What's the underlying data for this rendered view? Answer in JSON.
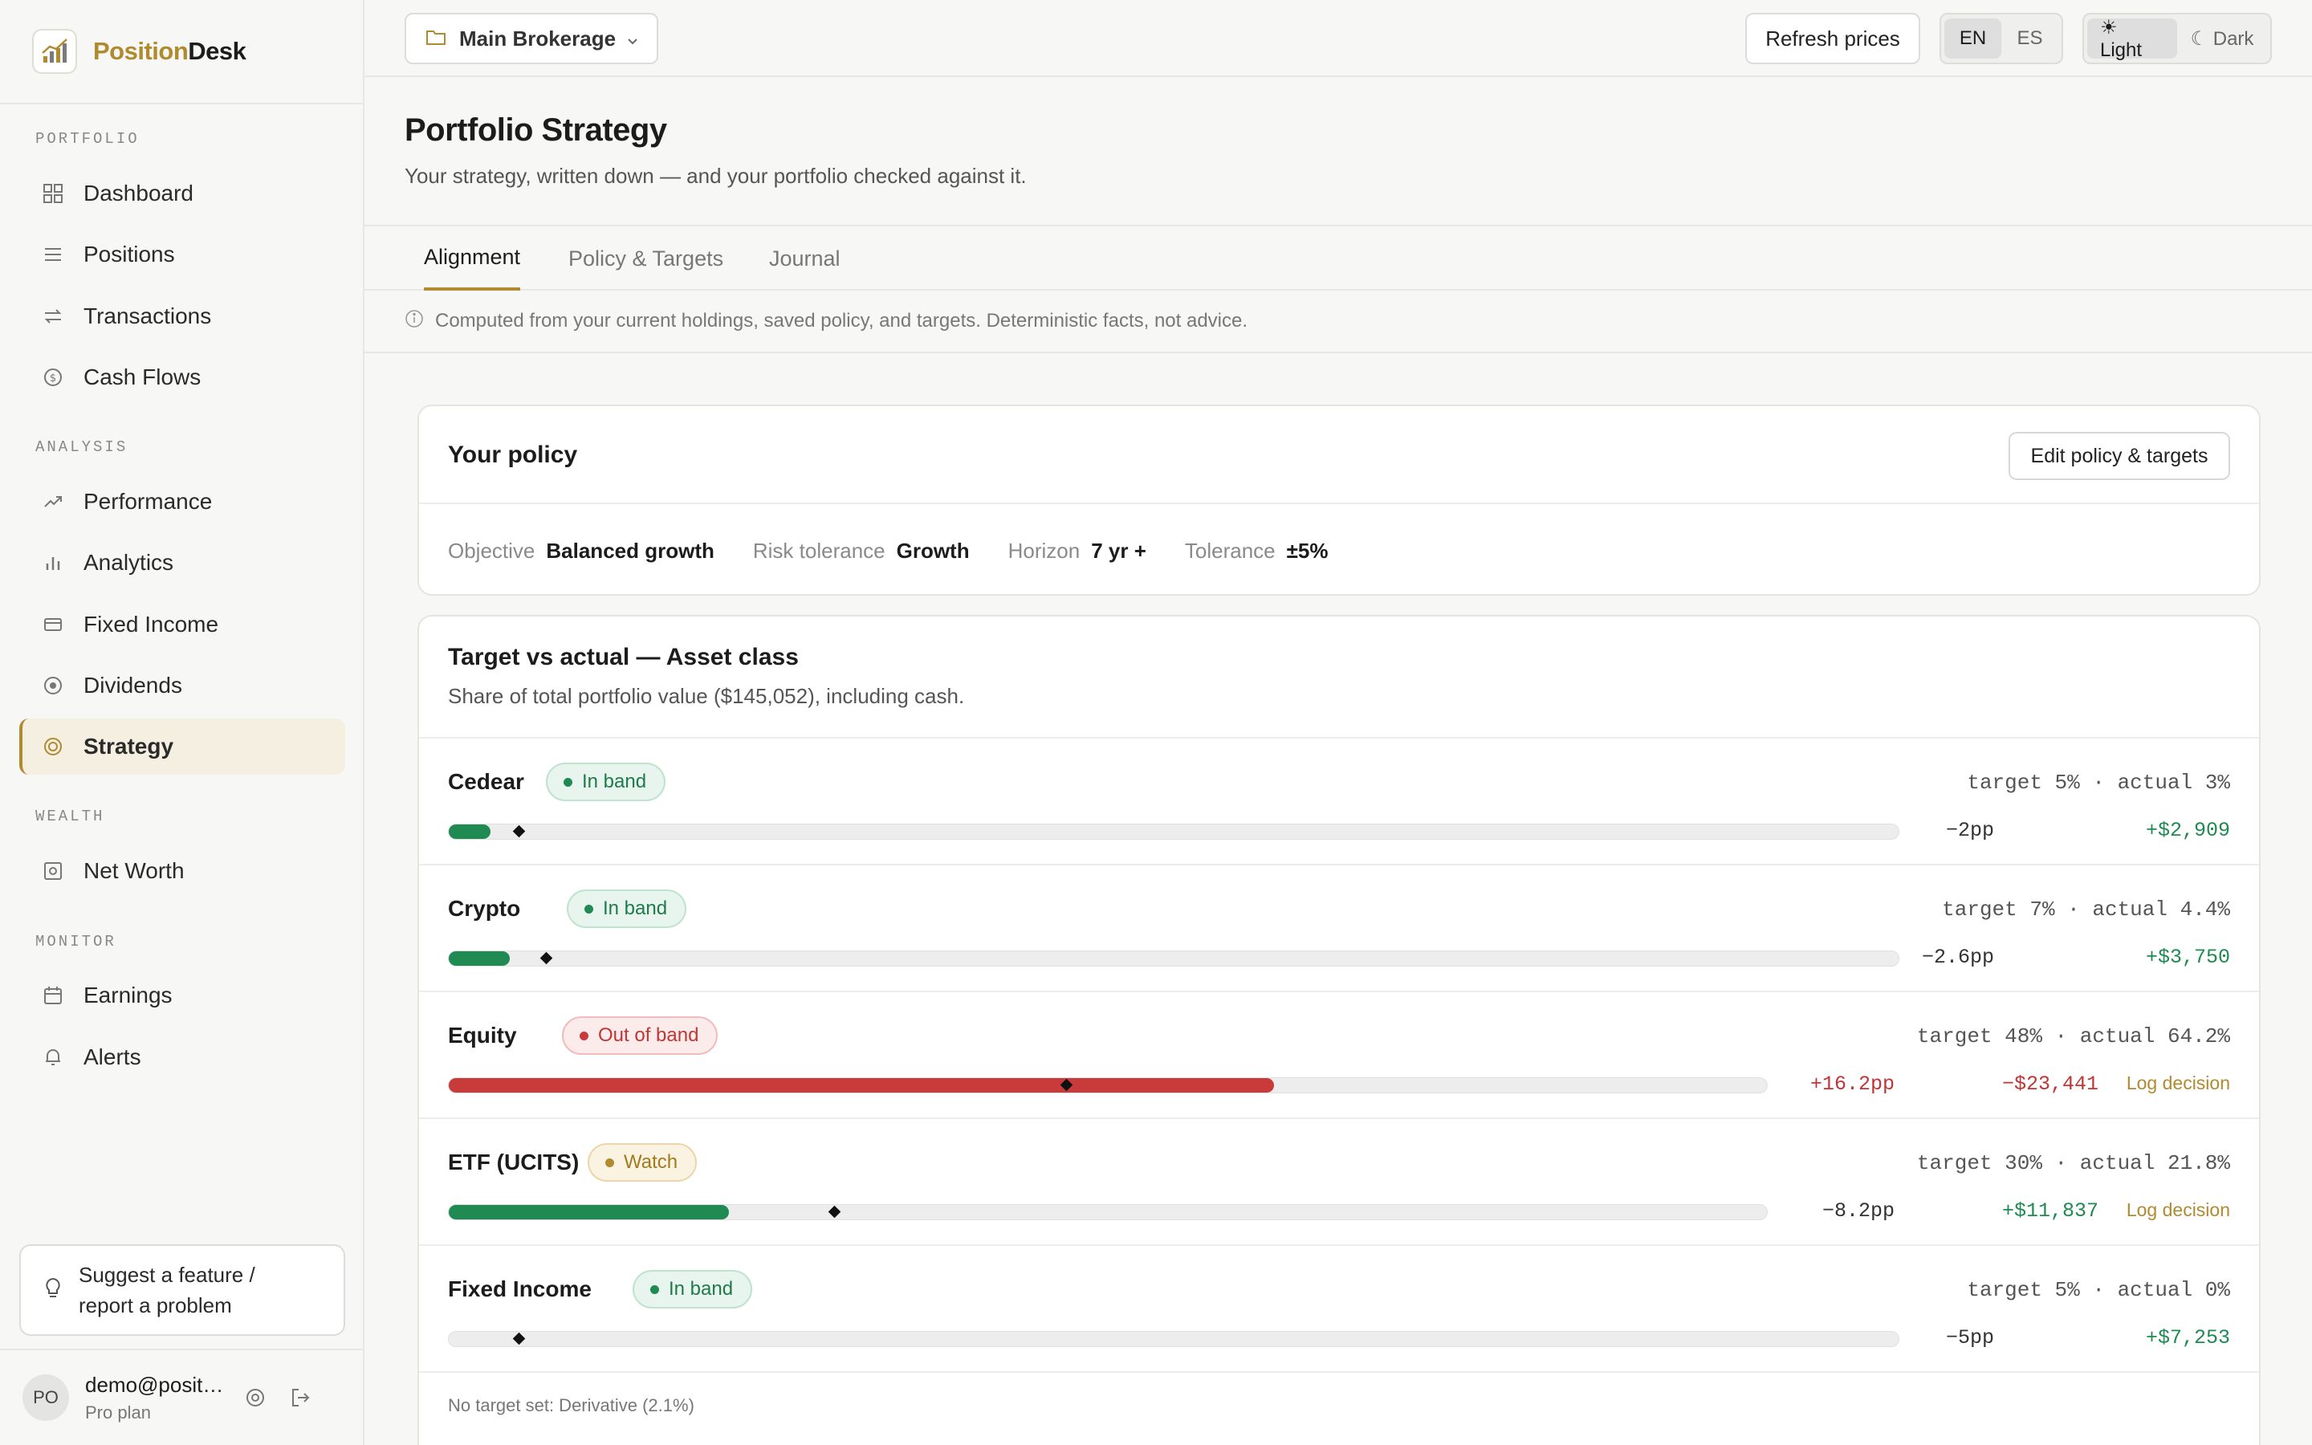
{
  "brand": {
    "name_part1": "Position",
    "name_part2": "Desk"
  },
  "sidebar": {
    "sections": [
      {
        "label": "PORTFOLIO"
      },
      {
        "label": "ANALYSIS"
      },
      {
        "label": "WEALTH"
      },
      {
        "label": "MONITOR"
      }
    ],
    "items": [
      {
        "label": "Dashboard",
        "icon": "grid-icon"
      },
      {
        "label": "Positions",
        "icon": "list-icon"
      },
      {
        "label": "Transactions",
        "icon": "arrows-icon"
      },
      {
        "label": "Cash Flows",
        "icon": "dollar-circle-icon"
      },
      {
        "label": "Performance",
        "icon": "trend-up-icon"
      },
      {
        "label": "Analytics",
        "icon": "bar-chart-icon"
      },
      {
        "label": "Fixed Income",
        "icon": "card-icon"
      },
      {
        "label": "Dividends",
        "icon": "dot-circle-icon"
      },
      {
        "label": "Strategy",
        "icon": "target-icon",
        "active": true
      },
      {
        "label": "Net Worth",
        "icon": "safe-icon"
      },
      {
        "label": "Earnings",
        "icon": "calendar-icon"
      },
      {
        "label": "Alerts",
        "icon": "bell-icon"
      }
    ],
    "suggest_label": "Suggest a feature / report a problem",
    "user": {
      "initials": "PO",
      "email": "demo@positiondesk.app",
      "plan": "Pro plan"
    }
  },
  "topbar": {
    "account": "Main Brokerage",
    "refresh_label": "Refresh prices",
    "lang": [
      "EN",
      "ES"
    ],
    "lang_selected": "EN",
    "theme_light": "☀ Light",
    "theme_dark": "☾ Dark",
    "theme_selected": "Light"
  },
  "page": {
    "title": "Portfolio Strategy",
    "subtitle": "Your strategy, written down — and your portfolio checked against it.",
    "tabs": [
      "Alignment",
      "Policy & Targets",
      "Journal"
    ],
    "active_tab": "Alignment",
    "note": "Computed from your current holdings, saved policy, and targets. Deterministic facts, not advice."
  },
  "policy": {
    "title": "Your policy",
    "edit_label": "Edit policy & targets",
    "fields": [
      {
        "label": "Objective",
        "value": "Balanced growth"
      },
      {
        "label": "Risk tolerance",
        "value": "Growth"
      },
      {
        "label": "Horizon",
        "value": "7 yr +"
      },
      {
        "label": "Tolerance",
        "value": "±5%"
      }
    ]
  },
  "allocation": {
    "title": "Target vs actual — Asset class",
    "subtitle": "Share of total portfolio value ($145,052), including cash.",
    "rows": [
      {
        "name": "Cedear",
        "status": "In band",
        "status_kind": "in",
        "summary": "target 5% · actual 3%",
        "target_pct": 5,
        "actual_pct": 3,
        "delta": "−2pp",
        "amount": "+$2,909",
        "amount_kind": "pos",
        "log": ""
      },
      {
        "name": "Crypto",
        "status": "In band",
        "status_kind": "in",
        "summary": "target 7% · actual 4.4%",
        "target_pct": 7,
        "actual_pct": 4.4,
        "delta": "−2.6pp",
        "amount": "+$3,750",
        "amount_kind": "pos",
        "log": ""
      },
      {
        "name": "Equity",
        "status": "Out of band",
        "status_kind": "out",
        "summary": "target 48% · actual 64.2%",
        "target_pct": 48,
        "actual_pct": 64.2,
        "delta": "+16.2pp",
        "amount": "−$23,441",
        "amount_kind": "neg",
        "log": "Log decision"
      },
      {
        "name": "ETF (UCITS)",
        "status": "Watch",
        "status_kind": "watch",
        "summary": "target 30% · actual 21.8%",
        "target_pct": 30,
        "actual_pct": 21.8,
        "delta": "−8.2pp",
        "amount": "+$11,837",
        "amount_kind": "pos",
        "log": "Log decision"
      },
      {
        "name": "Fixed Income",
        "status": "In band",
        "status_kind": "in",
        "summary": "target 5% · actual 0%",
        "target_pct": 5,
        "actual_pct": 0,
        "delta": "−5pp",
        "amount": "+$7,253",
        "amount_kind": "pos",
        "log": ""
      }
    ],
    "footnote": "No target set: Derivative (2.1%)"
  },
  "colors": {
    "accent": "#b08a2e",
    "in_band": "#1f8a52",
    "out_band": "#c93a3a",
    "positive": "#1f8a52",
    "negative": "#c03535"
  }
}
